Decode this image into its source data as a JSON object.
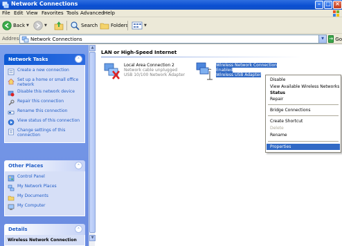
{
  "window": {
    "title": "Network Connections",
    "title_bar_color": "#0a4ed1"
  },
  "menu": {
    "items": [
      "File",
      "Edit",
      "View",
      "Favorites",
      "Tools",
      "Advanced",
      "Help"
    ]
  },
  "toolbar": {
    "back_label": "Back",
    "search_label": "Search",
    "folders_label": "Folders"
  },
  "address": {
    "label": "Address",
    "value": "Network Connections",
    "go_label": "Go"
  },
  "tasks_panel": {
    "title": "Network Tasks",
    "items": [
      {
        "label": "Create a new connection",
        "icon": "new-connection-icon"
      },
      {
        "label": "Set up a home or small office network",
        "icon": "home-network-icon"
      },
      {
        "label": "Disable this network device",
        "icon": "disable-device-icon"
      },
      {
        "label": "Repair this connection",
        "icon": "repair-icon"
      },
      {
        "label": "Rename this connection",
        "icon": "rename-icon"
      },
      {
        "label": "View status of this connection",
        "icon": "status-icon"
      },
      {
        "label": "Change settings of this connection",
        "icon": "settings-icon"
      }
    ]
  },
  "places_panel": {
    "title": "Other Places",
    "items": [
      {
        "label": "Control Panel",
        "icon": "control-panel-icon"
      },
      {
        "label": "My Network Places",
        "icon": "network-places-icon"
      },
      {
        "label": "My Documents",
        "icon": "documents-folder-icon"
      },
      {
        "label": "My Computer",
        "icon": "computer-icon"
      }
    ]
  },
  "details_panel": {
    "title": "Details",
    "name": "Wireless Network Connection"
  },
  "main": {
    "group_header": "LAN or High-Speed Internet",
    "connections": [
      {
        "name": "Local Area Connection 2",
        "status": "Network cable unplugged",
        "device": "USB 10/100 Network Adapter",
        "selected": false
      },
      {
        "name": "Wireless Network Connection",
        "status": "Enabled",
        "device": "Wireless USB Adapter",
        "selected": true
      }
    ]
  },
  "context_menu": {
    "items": [
      {
        "label": "Disable",
        "style": "normal"
      },
      {
        "label": "View Available Wireless Networks",
        "style": "normal"
      },
      {
        "label": "Status",
        "style": "bold"
      },
      {
        "label": "Repair",
        "style": "normal"
      },
      {
        "label": "Bridge Connections",
        "style": "normal"
      },
      {
        "label": "Create Shortcut",
        "style": "normal"
      },
      {
        "label": "Delete",
        "style": "disabled"
      },
      {
        "label": "Rename",
        "style": "normal"
      },
      {
        "label": "Properties",
        "style": "highlighted"
      }
    ],
    "highlight_color": "#316ac5"
  }
}
